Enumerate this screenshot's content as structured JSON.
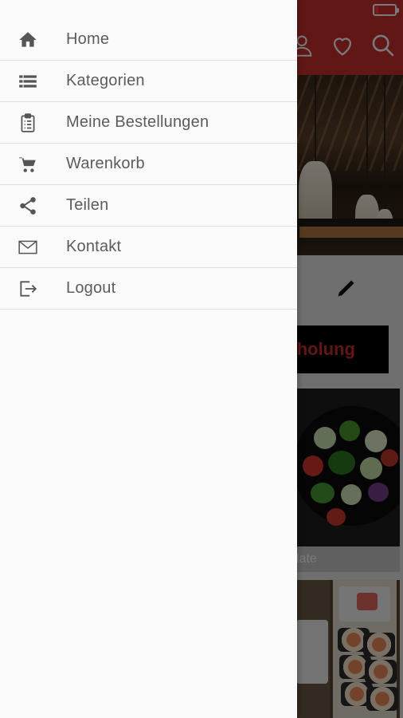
{
  "status_bar": {
    "battery_level": 0.15
  },
  "header": {
    "icons": [
      "user-icon",
      "heart-icon",
      "search-icon"
    ]
  },
  "main": {
    "pickup_button": {
      "label": "holung"
    },
    "tiles": [
      {
        "caption": "late"
      }
    ]
  },
  "drawer": {
    "items": [
      {
        "label": "Home",
        "icon": "home-icon"
      },
      {
        "label": "Kategorien",
        "icon": "list-icon"
      },
      {
        "label": "Meine Bestellungen",
        "icon": "clipboard-icon"
      },
      {
        "label": "Warenkorb",
        "icon": "cart-icon"
      },
      {
        "label": "Teilen",
        "icon": "share-icon"
      },
      {
        "label": "Kontakt",
        "icon": "mail-icon"
      },
      {
        "label": "Logout",
        "icon": "logout-icon"
      }
    ]
  },
  "colors": {
    "brand": "#c8302c",
    "drawer_bg": "#fafafa",
    "menu_text": "#5c5c5c",
    "icon": "#555555"
  }
}
